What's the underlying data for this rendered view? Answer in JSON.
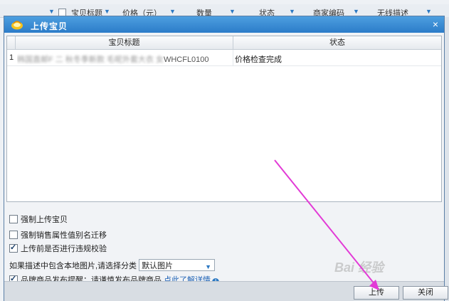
{
  "background_header": {
    "columns": [
      "宝贝标题",
      "价格（元）",
      "数量",
      "状态",
      "商家编码",
      "无线描述"
    ]
  },
  "dialog": {
    "title": "上传宝贝",
    "close": "×",
    "grid": {
      "columns": [
        "宝贝标题",
        "状态"
      ],
      "rows": [
        {
          "num": "1",
          "title_blurred": "韩国直邮F 二 秋冬季新款 毛呢外套大衣 女",
          "title_visible": "WHCFL0100",
          "status": "价格检查完成"
        }
      ]
    },
    "options": {
      "force_upload": "强制上传宝贝",
      "force_sales_attr": "强制销售属性值别名迁移",
      "check_violation": "上传前是否进行违规校验",
      "local_image_prompt": "如果描述中包含本地图片,请选择分类",
      "image_category": "默认图片",
      "brand_reminder": "品牌商品发布提醒：请谨慎发布品牌商品,",
      "brand_link": "点此了解详情"
    },
    "checks": {
      "force_upload": false,
      "force_sales_attr": false,
      "check_violation": true,
      "brand_reminder": true
    },
    "buttons": {
      "upload": "上传",
      "close": "关闭"
    }
  },
  "watermark": "Bai 经验",
  "colors": {
    "title_bar": "#2c7cc9",
    "arrow": "#e23ad6",
    "link": "#1a5fb4"
  }
}
